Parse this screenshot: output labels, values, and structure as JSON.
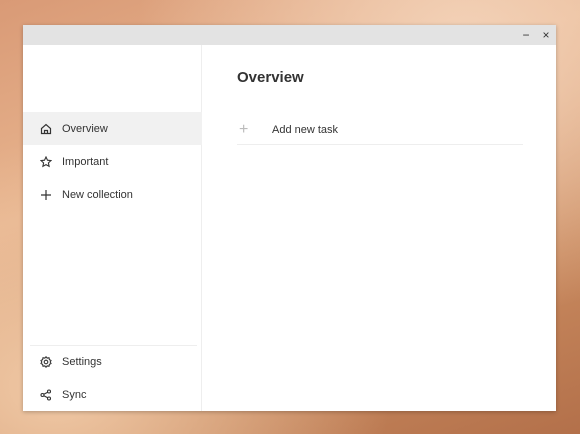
{
  "window": {
    "minimize": "−",
    "close": "×"
  },
  "sidebar": {
    "items": [
      {
        "label": "Overview",
        "icon": "home-icon",
        "active": true
      },
      {
        "label": "Important",
        "icon": "star-icon"
      },
      {
        "label": "New collection",
        "icon": "plus-icon"
      }
    ],
    "bottom": [
      {
        "label": "Settings",
        "icon": "gear-icon"
      },
      {
        "label": "Sync",
        "icon": "share-icon"
      }
    ]
  },
  "main": {
    "title": "Overview",
    "add_task": "Add new task",
    "add_icon": "+"
  }
}
